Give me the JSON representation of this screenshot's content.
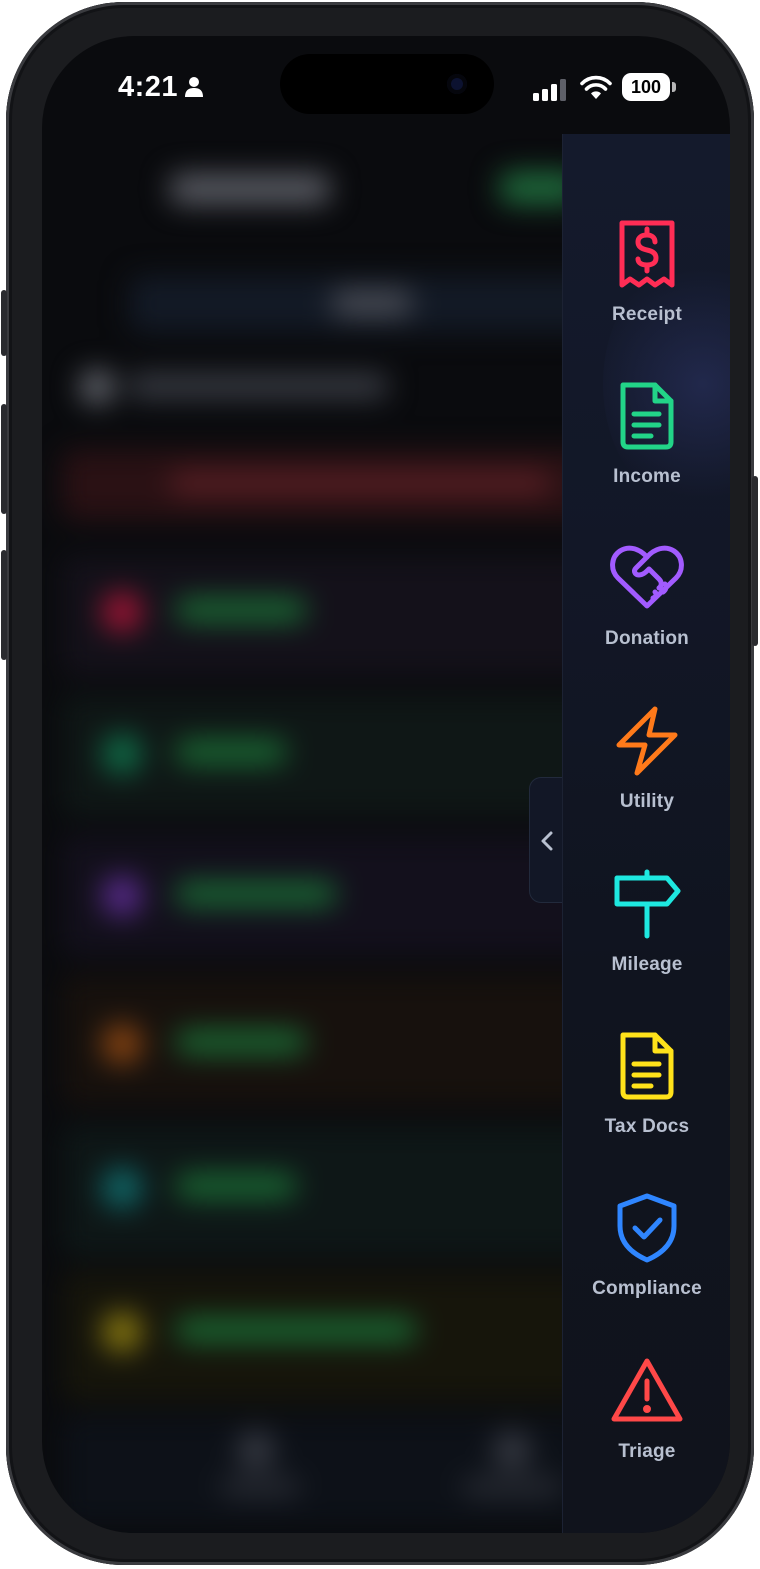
{
  "status_bar": {
    "time": "4:21",
    "battery": "100"
  },
  "action_rail": {
    "items": [
      {
        "label": "Receipt",
        "icon": "receipt-dollar-icon",
        "color": "#ff2d55"
      },
      {
        "label": "Income",
        "icon": "document-lines-icon",
        "color": "#22d488"
      },
      {
        "label": "Donation",
        "icon": "heart-handshake-icon",
        "color": "#a25bff"
      },
      {
        "label": "Utility",
        "icon": "lightning-bolt-icon",
        "color": "#ff7a1a"
      },
      {
        "label": "Mileage",
        "icon": "signpost-icon",
        "color": "#1ee8e0"
      },
      {
        "label": "Tax Docs",
        "icon": "tax-document-icon",
        "color": "#ffe21a"
      },
      {
        "label": "Compliance",
        "icon": "shield-check-icon",
        "color": "#2f86ff"
      },
      {
        "label": "Triage",
        "icon": "warning-triangle-icon",
        "color": "#ff4848"
      }
    ],
    "collapse_icon": "chevron-left-icon"
  }
}
